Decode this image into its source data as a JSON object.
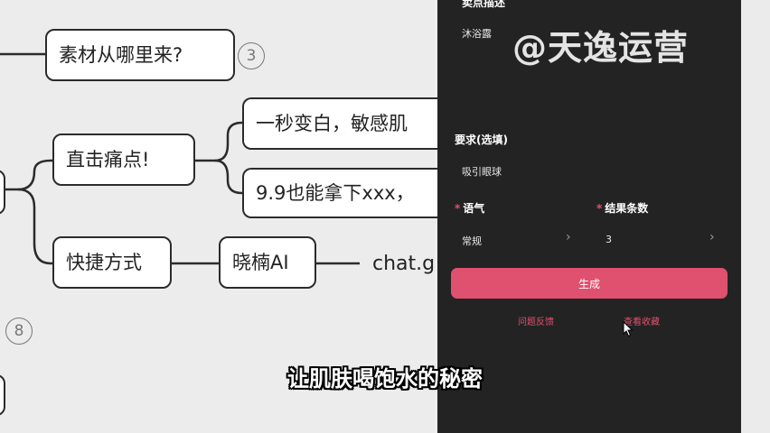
{
  "mindmap": {
    "node_material": "素材从哪里来?",
    "badge_material": "3",
    "node_painpoint": "直击痛点!",
    "child_white": "一秒变白，敏感肌",
    "child_price": "9.9也能拿下xxx，",
    "node_shortcut": "快捷方式",
    "node_tool": "晓楠AI",
    "link_text": "chat.g",
    "badge_lower": "8"
  },
  "panel": {
    "top_cut_label": "卖点描述",
    "product_value": "沐浴露",
    "requirement_label": "要求(选填)",
    "requirement_value": "吸引眼球",
    "tone_label": "语气",
    "tone_value": "常规",
    "count_label": "结果条数",
    "count_value": "3",
    "generate_button": "生成",
    "feedback_link": "问题反馈",
    "history_link": "查看收藏",
    "chevron": "›"
  },
  "watermark": "@天逸运营",
  "subtitle": "让肌肤喝饱水的秘密",
  "colors": {
    "accent": "#e0506f",
    "panel_bg": "#232323",
    "canvas_bg": "#ececec"
  }
}
